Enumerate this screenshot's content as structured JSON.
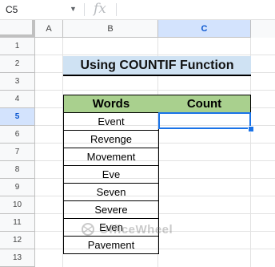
{
  "formula_bar": {
    "name_box": "C5",
    "fx_symbol": "fx",
    "formula": ""
  },
  "columns": [
    "A",
    "B",
    "C"
  ],
  "rows": [
    "1",
    "2",
    "3",
    "4",
    "5",
    "6",
    "7",
    "8",
    "9",
    "10",
    "11",
    "12",
    "13"
  ],
  "sheet": {
    "title": "Using COUNTIF Function",
    "table_headers": {
      "words": "Words",
      "count": "Count"
    },
    "words": [
      "Event",
      "Revenge",
      "Movement",
      "Eve",
      "Seven",
      "Severe",
      "Even",
      "Pavement"
    ],
    "count_values": [
      "",
      "",
      "",
      "",
      "",
      "",
      "",
      ""
    ]
  },
  "watermark": "OfficeWheel",
  "colors": {
    "title_fill": "#cfe2f3",
    "header_fill": "#a9d08e",
    "selection": "#1a73e8",
    "header_highlight": "#d3e3fd"
  }
}
